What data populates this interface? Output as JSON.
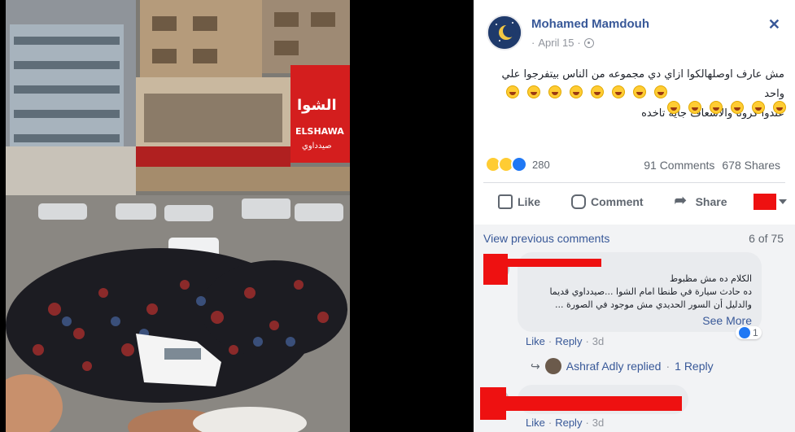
{
  "post": {
    "author": "Mohamed Mamdouh",
    "date": "April 15",
    "close_glyph": "✕",
    "text_line1": "مش عارف اوصلهالكوا ازاي دي مجموعه من الناس بيتفرجوا علي واحد",
    "text_line2": "عندوا كرونا والاسعاف جايه تاخده",
    "reaction_count": "280",
    "comments_count": "91 Comments",
    "shares_count": "678 Shares"
  },
  "actions": {
    "like": "Like",
    "comment": "Comment",
    "share": "Share"
  },
  "comments": {
    "view_previous": "View previous comments",
    "page": "6 of 75",
    "first": {
      "line1": "الكلام ده مش مظبوط",
      "line2": "ده حادث سيارة في طنطا امام الشوا ...صيدداوي قديما",
      "line3": "والدليل أن السور الحديدي مش موجود في الصورة ...",
      "see_more": "See More",
      "like_count": "1",
      "like_label": "Like",
      "reply_label": "Reply",
      "time": "3d"
    },
    "reply_summary": {
      "name": "Ashraf Adly replied",
      "count": "1 Reply"
    },
    "second": {
      "like_label": "Like",
      "reply_label": "Reply",
      "time": "3d"
    }
  },
  "photo": {
    "sign_arabic": "الشوا",
    "sign_brand": "ELSHAWA",
    "sign_sub": "صيدداوي"
  },
  "colors": {
    "link": "#385898",
    "redaction": "#ee1111",
    "page_bg": "#000000"
  }
}
